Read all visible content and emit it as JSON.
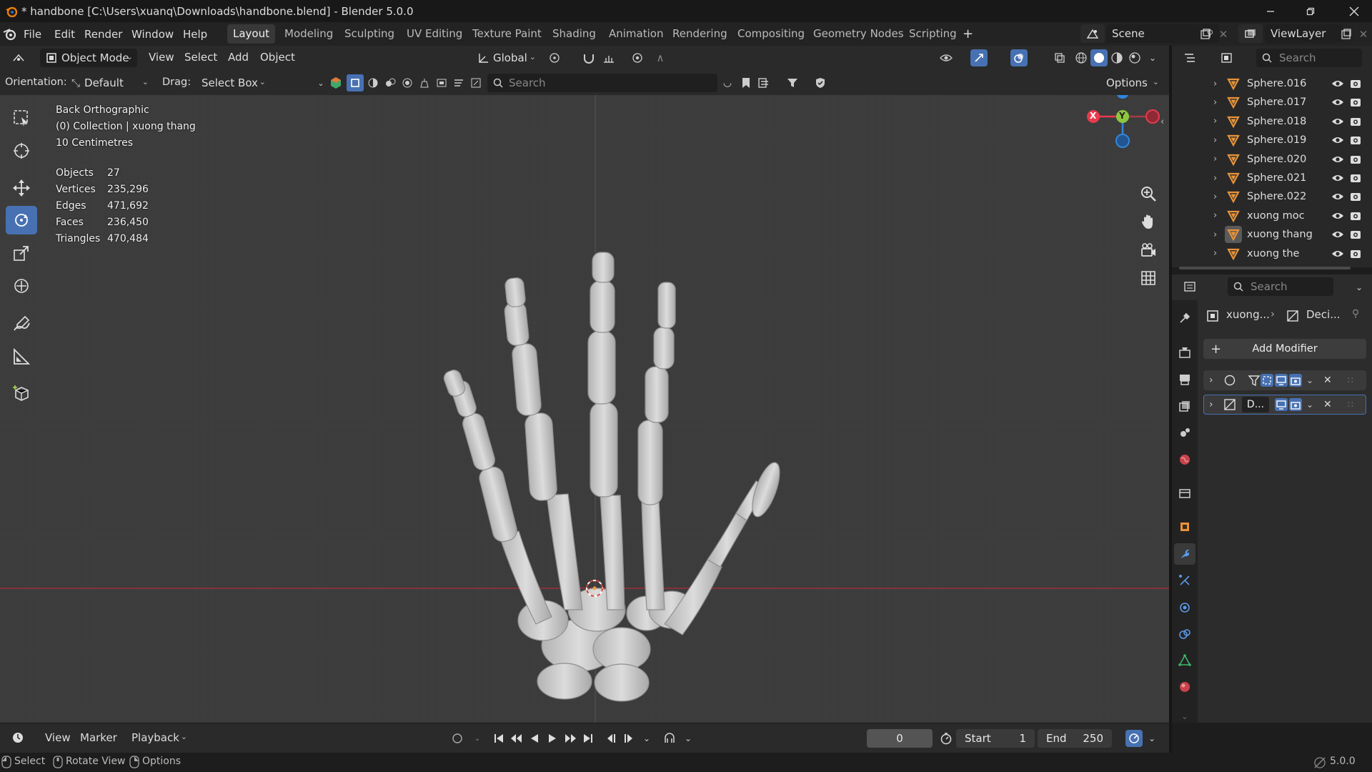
{
  "window": {
    "title": "* handbone [C:\\Users\\xuanq\\Downloads\\handbone.blend] - Blender 5.0.0",
    "minimize_icon": "minimize-icon",
    "maximize_icon": "maximize-icon",
    "close_icon": "close-icon"
  },
  "menu": [
    "File",
    "Edit",
    "Render",
    "Window",
    "Help"
  ],
  "workspaces": [
    "Layout",
    "Modeling",
    "Sculpting",
    "UV Editing",
    "Texture Paint",
    "Shading",
    "Animation",
    "Rendering",
    "Compositing",
    "Geometry Nodes",
    "Scripting"
  ],
  "active_workspace": "Layout",
  "scene": {
    "name": "Scene",
    "view_layer": "ViewLayer"
  },
  "header3d": {
    "mode": "Object Mode",
    "menus": [
      "View",
      "Select",
      "Add",
      "Object"
    ],
    "transform_orientation": "Global"
  },
  "toolset": {
    "orientation_label": "Orientation:",
    "orientation_value": "Default",
    "drag_label": "Drag:",
    "drag_value": "Select Box",
    "search_placeholder": "Search",
    "options_label": "Options"
  },
  "viewport": {
    "view_name": "Back Orthographic",
    "collection_line": "(0) Collection | xuong thang",
    "scale_line": "10 Centimetres",
    "stats": [
      {
        "label": "Objects",
        "value": "27"
      },
      {
        "label": "Vertices",
        "value": "235,296"
      },
      {
        "label": "Edges",
        "value": "471,692"
      },
      {
        "label": "Faces",
        "value": "236,450"
      },
      {
        "label": "Triangles",
        "value": "470,484"
      }
    ],
    "background_color": "#3c3c3c",
    "bone_color": "#d4d4d4",
    "axis_x_color": "#e8394d",
    "axis_y_color": "#8ec63f",
    "axis_z_color": "#2f86e0"
  },
  "gizmo": {
    "x": "X",
    "y": "Y",
    "z": "Z"
  },
  "tools": [
    "select-box-icon",
    "cursor-icon",
    "move-icon",
    "rotate-icon",
    "scale-icon",
    "transform-icon",
    "annotate-icon",
    "measure-icon",
    "add-cube-icon"
  ],
  "active_tool": "rotate-icon",
  "outliner": {
    "search_placeholder": "Search",
    "items": [
      {
        "name": "Sphere.016"
      },
      {
        "name": "Sphere.017"
      },
      {
        "name": "Sphere.018"
      },
      {
        "name": "Sphere.019"
      },
      {
        "name": "Sphere.020"
      },
      {
        "name": "Sphere.021"
      },
      {
        "name": "Sphere.022"
      },
      {
        "name": "xuong moc"
      },
      {
        "name": "xuong thang"
      },
      {
        "name": "xuong the"
      }
    ]
  },
  "properties": {
    "search_placeholder": "Search",
    "breadcrumb_object": "xuong...",
    "breadcrumb_modifier": "Deci...",
    "add_modifier_label": "Add Modifier",
    "modifier2_name": "D..."
  },
  "timeline": {
    "menus": [
      "View",
      "Marker",
      "Playback"
    ],
    "current_frame": "0",
    "start_label": "Start",
    "start_value": "1",
    "end_label": "End",
    "end_value": "250"
  },
  "statusbar": {
    "hints": [
      "Select",
      "Rotate View",
      "Options"
    ],
    "version": "5.0.0"
  },
  "colors": {
    "accent": "#4771b2",
    "outliner_icon": "#e8933a"
  }
}
